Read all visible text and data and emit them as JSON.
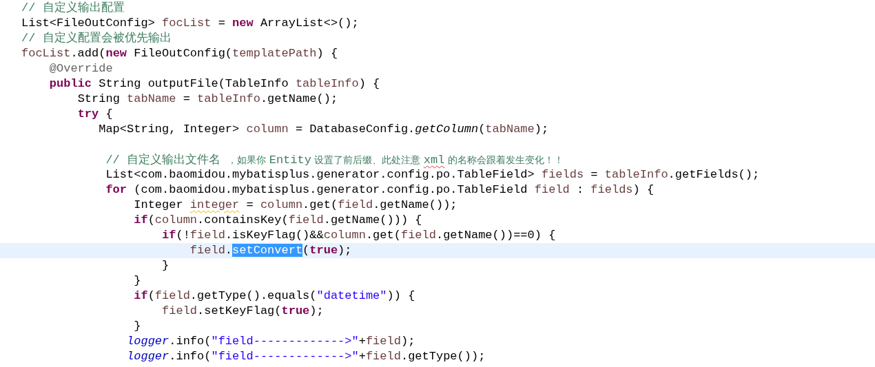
{
  "editor": {
    "lines": [
      {
        "current": false,
        "tokens": [
          {
            "kind": "comment",
            "text": "// 自定义输出配置"
          }
        ]
      },
      {
        "current": false,
        "tokens": [
          {
            "kind": "plain",
            "text": "List<FileOutConfig> "
          },
          {
            "kind": "variable",
            "text": "focList"
          },
          {
            "kind": "plain",
            "text": " = "
          },
          {
            "kind": "keyword",
            "text": "new"
          },
          {
            "kind": "plain",
            "text": " ArrayList<>();"
          }
        ]
      },
      {
        "current": false,
        "tokens": [
          {
            "kind": "comment",
            "text": "// 自定义配置会被优先输出"
          }
        ]
      },
      {
        "current": false,
        "tokens": [
          {
            "kind": "variable",
            "text": "focList"
          },
          {
            "kind": "plain",
            "text": ".add("
          },
          {
            "kind": "keyword",
            "text": "new"
          },
          {
            "kind": "plain",
            "text": " FileOutConfig("
          },
          {
            "kind": "variable",
            "text": "templatePath"
          },
          {
            "kind": "plain",
            "text": ") {"
          }
        ]
      },
      {
        "current": false,
        "tokens": [
          {
            "kind": "annotation",
            "text": "@Override"
          }
        ]
      },
      {
        "current": false,
        "tokens": [
          {
            "kind": "keyword",
            "text": "public"
          },
          {
            "kind": "plain",
            "text": " String outputFile(TableInfo "
          },
          {
            "kind": "variable",
            "text": "tableInfo"
          },
          {
            "kind": "plain",
            "text": ") {"
          }
        ]
      },
      {
        "current": false,
        "tokens": [
          {
            "kind": "plain",
            "text": "String "
          },
          {
            "kind": "variable",
            "text": "tabName"
          },
          {
            "kind": "plain",
            "text": " = "
          },
          {
            "kind": "variable",
            "text": "tableInfo"
          },
          {
            "kind": "plain",
            "text": ".getName();"
          }
        ]
      },
      {
        "current": false,
        "tokens": [
          {
            "kind": "keyword",
            "text": "try"
          },
          {
            "kind": "plain",
            "text": " {"
          }
        ]
      },
      {
        "current": false,
        "tokens": [
          {
            "kind": "plain",
            "text": "Map<String, Integer> "
          },
          {
            "kind": "variable",
            "text": "column"
          },
          {
            "kind": "plain",
            "text": " = DatabaseConfig."
          },
          {
            "kind": "static-method",
            "text": "getColumn"
          },
          {
            "kind": "plain",
            "text": "("
          },
          {
            "kind": "variable",
            "text": "tabName"
          },
          {
            "kind": "plain",
            "text": ");"
          }
        ]
      },
      {
        "current": false
      },
      {
        "current": false,
        "tokens": [
          {
            "kind": "comment",
            "text": "// 自定义输出文件名 "
          },
          {
            "kind": "note",
            "text": "，如果你 "
          },
          {
            "kind": "comment",
            "text": "Entity"
          },
          {
            "kind": "note",
            "text": " 设置了前后缀、此处注意 "
          },
          {
            "kind": "comment",
            "text": "xml",
            "misspelled": true
          },
          {
            "kind": "note",
            "text": " 的名称会跟着发生变化！！"
          }
        ]
      },
      {
        "current": false,
        "tokens": [
          {
            "kind": "plain",
            "text": "List<com.baomidou.mybatisplus.generator.config.po.TableField> "
          },
          {
            "kind": "variable",
            "text": "fields"
          },
          {
            "kind": "plain",
            "text": " = "
          },
          {
            "kind": "variable",
            "text": "tableInfo"
          },
          {
            "kind": "plain",
            "text": ".getFields();"
          }
        ]
      },
      {
        "current": false,
        "tokens": [
          {
            "kind": "keyword",
            "text": "for"
          },
          {
            "kind": "plain",
            "text": " (com.baomidou.mybatisplus.generator.config.po.TableField "
          },
          {
            "kind": "variable",
            "text": "field"
          },
          {
            "kind": "plain",
            "text": " : "
          },
          {
            "kind": "variable",
            "text": "fields"
          },
          {
            "kind": "plain",
            "text": ") {"
          }
        ]
      },
      {
        "current": false,
        "tokens": [
          {
            "kind": "plain",
            "text": "Integer "
          },
          {
            "kind": "variable",
            "text": "integer",
            "warning": true
          },
          {
            "kind": "plain",
            "text": " = "
          },
          {
            "kind": "variable",
            "text": "column"
          },
          {
            "kind": "plain",
            "text": ".get("
          },
          {
            "kind": "variable",
            "text": "field"
          },
          {
            "kind": "plain",
            "text": ".getName());"
          }
        ]
      },
      {
        "current": false,
        "tokens": [
          {
            "kind": "keyword",
            "text": "if"
          },
          {
            "kind": "plain",
            "text": "("
          },
          {
            "kind": "variable",
            "text": "column"
          },
          {
            "kind": "plain",
            "text": ".containsKey("
          },
          {
            "kind": "variable",
            "text": "field"
          },
          {
            "kind": "plain",
            "text": ".getName())) {"
          }
        ]
      },
      {
        "current": false,
        "tokens": [
          {
            "kind": "keyword",
            "text": "if"
          },
          {
            "kind": "plain",
            "text": "(!"
          },
          {
            "kind": "variable",
            "text": "field"
          },
          {
            "kind": "plain",
            "text": ".isKeyFlag()&&"
          },
          {
            "kind": "variable",
            "text": "column"
          },
          {
            "kind": "plain",
            "text": ".get("
          },
          {
            "kind": "variable",
            "text": "field"
          },
          {
            "kind": "plain",
            "text": ".getName())==0) {"
          }
        ]
      },
      {
        "current": true,
        "tokens": [
          {
            "kind": "variable",
            "text": "field",
            "selected": false
          },
          {
            "kind": "plain",
            "text": ".",
            "selected": false
          },
          {
            "kind": "plain",
            "text": "setConvert",
            "selected": true
          },
          {
            "kind": "plain",
            "text": "(",
            "selected": false
          },
          {
            "kind": "keyword",
            "text": "true",
            "selected": false
          },
          {
            "kind": "plain",
            "text": ");",
            "selected": false
          }
        ]
      },
      {
        "current": false,
        "tokens": [
          {
            "kind": "plain",
            "text": "}"
          }
        ]
      },
      {
        "current": false,
        "tokens": [
          {
            "kind": "plain",
            "text": "}"
          }
        ]
      },
      {
        "current": false,
        "tokens": [
          {
            "kind": "keyword",
            "text": "if"
          },
          {
            "kind": "plain",
            "text": "("
          },
          {
            "kind": "variable",
            "text": "field"
          },
          {
            "kind": "plain",
            "text": ".getType().equals("
          },
          {
            "kind": "string",
            "text": "\"datetime\""
          },
          {
            "kind": "plain",
            "text": ")) {"
          }
        ]
      },
      {
        "current": false,
        "tokens": [
          {
            "kind": "variable",
            "text": "field"
          },
          {
            "kind": "plain",
            "text": ".setKeyFlag("
          },
          {
            "kind": "keyword",
            "text": "true"
          },
          {
            "kind": "plain",
            "text": ");"
          }
        ]
      },
      {
        "current": false,
        "tokens": [
          {
            "kind": "plain",
            "text": "}"
          }
        ]
      },
      {
        "current": false,
        "tokens": [
          {
            "kind": "static-field",
            "text": "logger"
          },
          {
            "kind": "plain",
            "text": ".info("
          },
          {
            "kind": "string",
            "text": "\"field------------->\""
          },
          {
            "kind": "plain",
            "text": "+"
          },
          {
            "kind": "variable",
            "text": "field"
          },
          {
            "kind": "plain",
            "text": ");"
          }
        ]
      },
      {
        "current": false,
        "tokens": [
          {
            "kind": "static-field",
            "text": "logger"
          },
          {
            "kind": "plain",
            "text": ".info("
          },
          {
            "kind": "string",
            "text": "\"field------------->\""
          },
          {
            "kind": "plain",
            "text": "+"
          },
          {
            "kind": "variable",
            "text": "field"
          },
          {
            "kind": "plain",
            "text": ".getType());"
          }
        ]
      }
    ]
  }
}
